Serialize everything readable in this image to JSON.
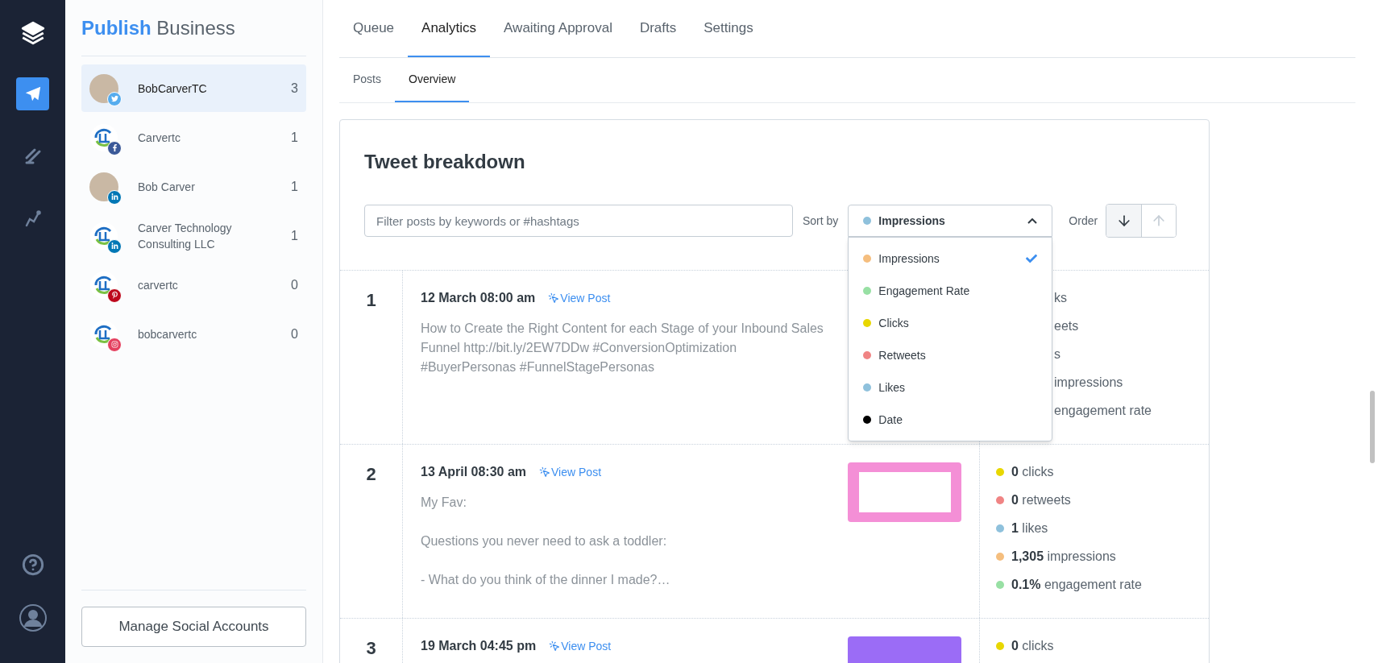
{
  "brand": {
    "highlight": "Publish",
    "rest": "Business"
  },
  "rail": [
    {
      "kind": "publish",
      "selected": true
    },
    {
      "kind": "engage",
      "selected": false
    },
    {
      "kind": "analyze",
      "selected": false
    }
  ],
  "accounts": [
    {
      "name": "BobCarverTC",
      "count": "3",
      "badge": {
        "kind": "twitter"
      },
      "avatar": {
        "kind": "photo"
      },
      "selected": true
    },
    {
      "name": "Carvertc",
      "count": "1",
      "badge": {
        "kind": "facebook"
      },
      "avatar": {
        "kind": "logo"
      },
      "selected": false
    },
    {
      "name": "Bob Carver",
      "count": "1",
      "badge": {
        "kind": "linkedin"
      },
      "avatar": {
        "kind": "photo"
      },
      "selected": false
    },
    {
      "name": "Carver Technology Consulting LLC",
      "count": "1",
      "badge": {
        "kind": "linkedin"
      },
      "avatar": {
        "kind": "logo"
      },
      "selected": false
    },
    {
      "name": "carvertc",
      "count": "0",
      "badge": {
        "kind": "pinterest"
      },
      "avatar": {
        "kind": "logo"
      },
      "selected": false
    },
    {
      "name": "bobcarvertc",
      "count": "0",
      "badge": {
        "kind": "instagram"
      },
      "avatar": {
        "kind": "logo"
      },
      "selected": false
    }
  ],
  "manage_button": "Manage Social Accounts",
  "tabs": [
    {
      "label": "Queue",
      "selected": false
    },
    {
      "label": "Analytics",
      "selected": true
    },
    {
      "label": "Awaiting Approval",
      "selected": false
    },
    {
      "label": "Drafts",
      "selected": false
    },
    {
      "label": "Settings",
      "selected": false
    }
  ],
  "subtabs": [
    {
      "label": "Posts",
      "selected": false
    },
    {
      "label": "Overview",
      "selected": true
    }
  ],
  "card": {
    "title": "Tweet breakdown",
    "filter": {
      "placeholder": "Filter posts by keywords or #hashtags"
    },
    "sort_label": "Sort by",
    "sort": {
      "value": "Impressions",
      "color": "#8fc1dc",
      "open": true,
      "options": [
        {
          "label": "Impressions",
          "color": "#f5be7e",
          "selected": true
        },
        {
          "label": "Engagement Rate",
          "color": "#98e0a4",
          "selected": false
        },
        {
          "label": "Clicks",
          "color": "#e8d700",
          "selected": false
        },
        {
          "label": "Retweets",
          "color": "#f08484",
          "selected": false
        },
        {
          "label": "Likes",
          "color": "#8fc1dc",
          "selected": false
        },
        {
          "label": "Date",
          "color": "#000000",
          "selected": false
        }
      ]
    },
    "order_label": "Order",
    "order": [
      {
        "kind": "descending",
        "selected": true
      },
      {
        "kind": "ascending",
        "selected": false
      }
    ]
  },
  "posts": [
    {
      "number": "1",
      "date": "12 March 08:00 am",
      "link": "View Post",
      "text": [
        "How to Create the Right Content for each Stage of your Inbound Sales Funnel http://bit.ly/2EW7DDw #ConversionOptimization #BuyerPersonas #FunnelStagePersonas"
      ],
      "stats": [
        {
          "label": "ks"
        },
        {
          "label": "eets"
        },
        {
          "label": "s"
        },
        {
          "label": "impressions"
        },
        {
          "label": "engagement rate"
        }
      ]
    },
    {
      "number": "2",
      "date": "13 April 08:30 am",
      "link": "View Post",
      "thumbnail": {
        "kind": "tweet"
      },
      "text": [
        "My Fav:",
        "Questions you never need to ask a toddler:",
        "- What do you think of the dinner I made?…"
      ],
      "stats": [
        {
          "value": "0",
          "label": "clicks",
          "color": "#e8d700"
        },
        {
          "value": "0",
          "label": "retweets",
          "color": "#f08484"
        },
        {
          "value": "1",
          "label": "likes",
          "color": "#8fc1dc"
        },
        {
          "value": "1,305",
          "label": "impressions",
          "color": "#f5be7e"
        },
        {
          "value": "0.1%",
          "label": "engagement rate",
          "color": "#98e0a4"
        }
      ]
    },
    {
      "number": "3",
      "date": "19 March 04:45 pm",
      "link": "View Post",
      "thumbnail": {
        "kind": "plain"
      },
      "stats": [
        {
          "value": "0",
          "label": "clicks",
          "color": "#e8d700"
        }
      ]
    }
  ]
}
